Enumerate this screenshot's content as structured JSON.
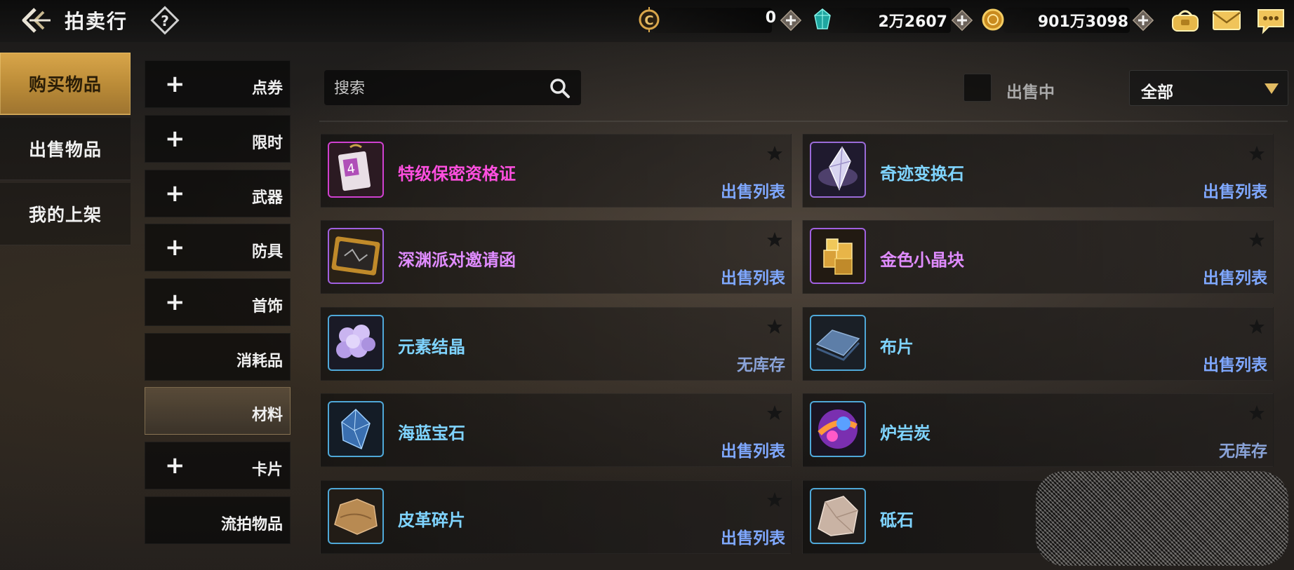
{
  "header": {
    "title": "拍卖行",
    "currency": [
      {
        "icon": "coupon-c-icon",
        "value": "0"
      },
      {
        "icon": "crystal-icon",
        "value": "2万2607"
      },
      {
        "icon": "gold-coin-icon",
        "value": "901万3098"
      }
    ]
  },
  "tabs": [
    {
      "label": "购买物品",
      "active": true
    },
    {
      "label": "出售物品",
      "active": false
    },
    {
      "label": "我的上架",
      "active": false
    }
  ],
  "categories": [
    {
      "label": "点券",
      "expandable": true
    },
    {
      "label": "限时",
      "expandable": true
    },
    {
      "label": "武器",
      "expandable": true
    },
    {
      "label": "防具",
      "expandable": true
    },
    {
      "label": "首饰",
      "expandable": true
    },
    {
      "label": "消耗品",
      "expandable": false
    },
    {
      "label": "材料",
      "expandable": false,
      "active": true
    },
    {
      "label": "卡片",
      "expandable": true
    },
    {
      "label": "流拍物品",
      "expandable": false
    }
  ],
  "filters": {
    "search_placeholder": "搜索",
    "selling_label": "出售中",
    "selling_checked": false,
    "dropdown_value": "全部"
  },
  "items": [
    {
      "name": "特级保密资格证",
      "status": "出售列表",
      "name_color": "#ff4fe0",
      "icon": "secret-pass-icon"
    },
    {
      "name": "奇迹变换石",
      "status": "出售列表",
      "name_color": "#7fd4ff",
      "icon": "crystal-stone-icon"
    },
    {
      "name": "深渊派对邀请函",
      "status": "出售列表",
      "name_color": "#e08cff",
      "icon": "invitation-card-icon"
    },
    {
      "name": "金色小晶块",
      "status": "出售列表",
      "name_color": "#e08cff",
      "icon": "gold-cubes-icon"
    },
    {
      "name": "元素结晶",
      "status": "无库存",
      "name_color": "#7fd4ff",
      "icon": "element-crystal-icon"
    },
    {
      "name": "布片",
      "status": "出售列表",
      "name_color": "#7fd4ff",
      "icon": "cloth-icon"
    },
    {
      "name": "海蓝宝石",
      "status": "出售列表",
      "name_color": "#7fd4ff",
      "icon": "aquamarine-icon"
    },
    {
      "name": "炉岩炭",
      "status": "无库存",
      "name_color": "#7fd4ff",
      "icon": "lava-orb-icon"
    },
    {
      "name": "皮革碎片",
      "status": "出售列表",
      "name_color": "#7fd4ff",
      "icon": "leather-icon"
    },
    {
      "name": "砥石",
      "status": "",
      "name_color": "#7fd4ff",
      "icon": "whetstone-icon"
    }
  ],
  "colors": {
    "status_available": "#7fa8ff",
    "status_out": "#8aa3d8",
    "accent_gold": "#d9a64a"
  }
}
